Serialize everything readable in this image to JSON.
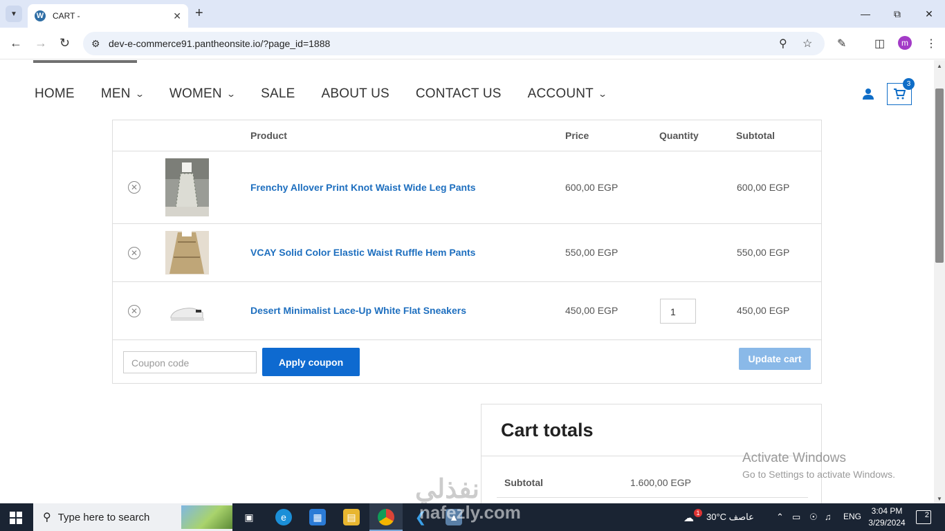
{
  "browser": {
    "tab_title": "CART -",
    "favicon": "W",
    "url": "dev-e-commerce91.pantheonsite.io/?page_id=1888",
    "profile_initial": "m"
  },
  "nav": {
    "items": [
      {
        "label": "HOME",
        "has_dropdown": false
      },
      {
        "label": "MEN",
        "has_dropdown": true
      },
      {
        "label": "WOMEN",
        "has_dropdown": true
      },
      {
        "label": "SALE",
        "has_dropdown": false
      },
      {
        "label": "ABOUT US",
        "has_dropdown": false
      },
      {
        "label": "CONTACT US",
        "has_dropdown": false
      },
      {
        "label": "ACCOUNT",
        "has_dropdown": true
      }
    ],
    "cart_count": "3"
  },
  "cart": {
    "headers": {
      "product": "Product",
      "price": "Price",
      "quantity": "Quantity",
      "subtotal": "Subtotal"
    },
    "rows": [
      {
        "name": "Frenchy Allover Print Knot Waist Wide Leg Pants",
        "price": "600,00 EGP",
        "quantity": "",
        "subtotal": "600,00 EGP"
      },
      {
        "name": "VCAY Solid Color Elastic Waist Ruffle Hem Pants",
        "price": "550,00 EGP",
        "quantity": "",
        "subtotal": "550,00 EGP"
      },
      {
        "name": "Desert Minimalist Lace-Up White Flat Sneakers",
        "price": "450,00 EGP",
        "quantity": "1",
        "subtotal": "450,00 EGP"
      }
    ],
    "coupon_placeholder": "Coupon code",
    "apply_label": "Apply coupon",
    "update_label": "Update cart"
  },
  "totals": {
    "title": "Cart totals",
    "subtotal_label": "Subtotal",
    "subtotal_value": "1.600,00 EGP"
  },
  "activate": {
    "line1": "Activate Windows",
    "line2": "Go to Settings to activate Windows."
  },
  "watermark": {
    "arabic": "نفذلي",
    "latin": "nafezly.com"
  },
  "taskbar": {
    "search_text": "Type here to search",
    "weather": "30°C  عاصف",
    "weather_badge": "1",
    "lang": "ENG",
    "time": "3:04 PM",
    "date": "3/29/2024",
    "notifications": "2"
  },
  "colors": {
    "accent": "#0e6ad0",
    "link": "#1e6fbf",
    "update_disabled": "#8ab9e8"
  }
}
